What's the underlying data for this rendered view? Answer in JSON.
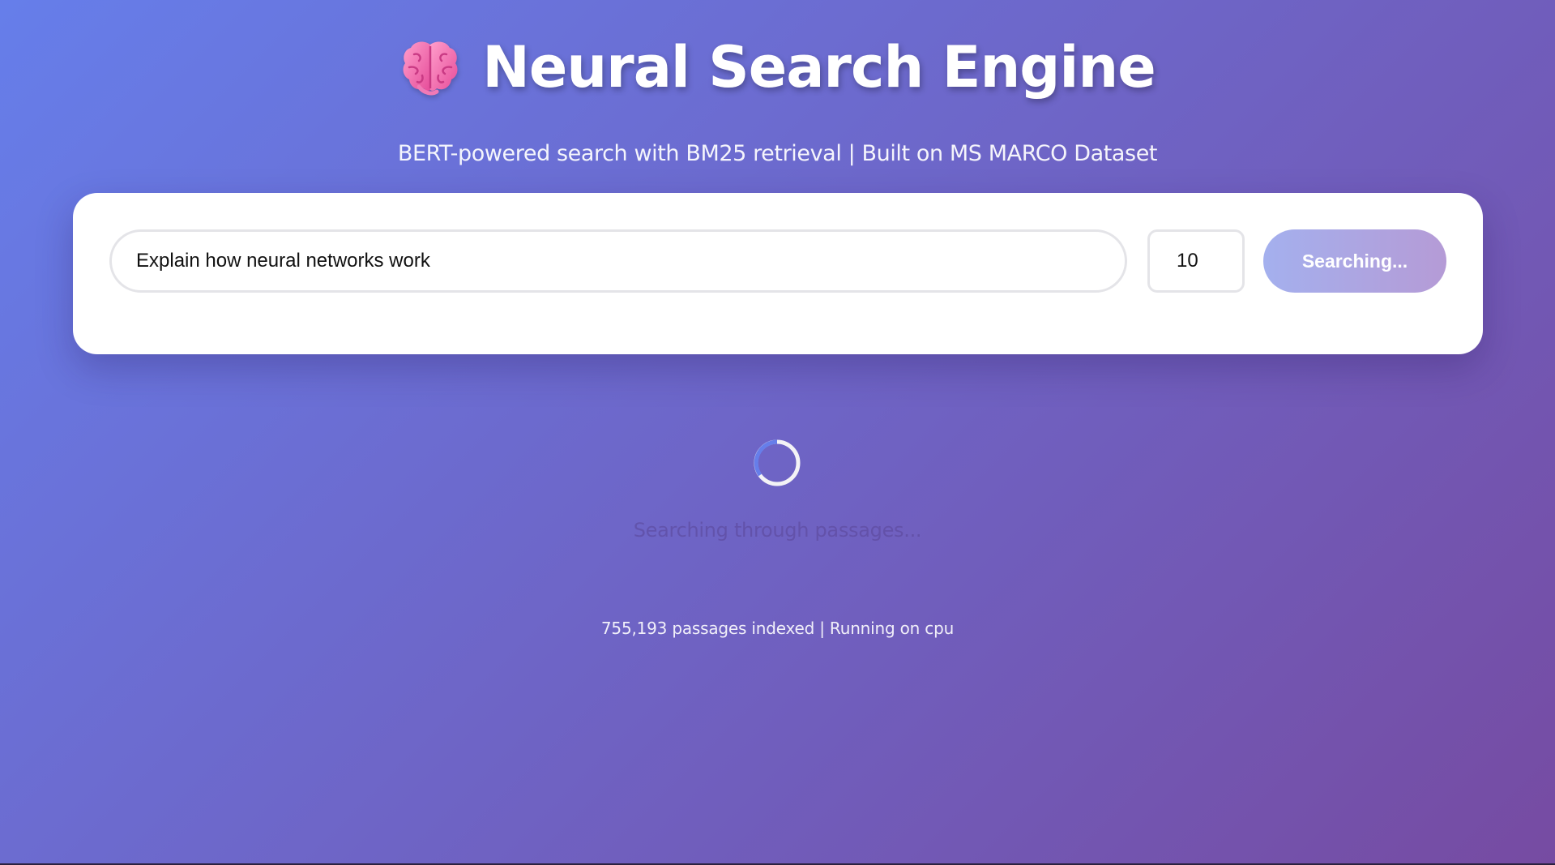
{
  "header": {
    "icon": "brain-icon",
    "title": "Neural Search Engine",
    "subtitle": "BERT-powered search with BM25 retrieval | Built on MS MARCO Dataset"
  },
  "search": {
    "query_value": "Explain how neural networks work",
    "result_count_value": "10",
    "button_label": "Searching...",
    "button_disabled": true
  },
  "loading": {
    "spinner_icon": "spinner-icon",
    "text": "Searching through passages..."
  },
  "footer": {
    "stats": "755,193 passages indexed | Running on cpu"
  },
  "colors": {
    "gradient_start": "#667eea",
    "gradient_end": "#764ba2",
    "card_background": "#ffffff",
    "button_gradient_start": "#a4b0ee",
    "button_gradient_end": "#b59bd6",
    "spinner_accent": "#667eea"
  }
}
